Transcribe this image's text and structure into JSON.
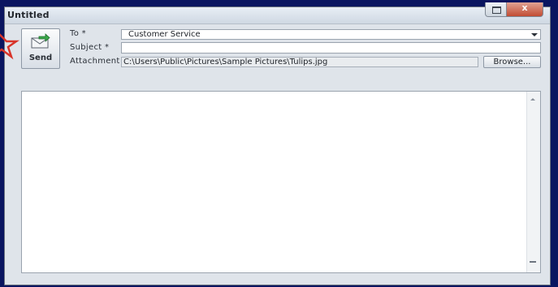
{
  "window": {
    "title": "Untitled",
    "close_label": "x",
    "accent_color": "#c24c33"
  },
  "toolbar": {
    "send_label": "Send",
    "send_icon": "envelope-send-icon"
  },
  "form": {
    "to_label": "To *",
    "to_value": "Customer Service",
    "subject_label": "Subject *",
    "subject_value": "",
    "attachment_label": "Attachment",
    "attachment_value": "C:\\Users\\Public\\Pictures\\Sample Pictures\\Tulips.jpg",
    "browse_label": "Browse..."
  },
  "message": {
    "body": ""
  }
}
